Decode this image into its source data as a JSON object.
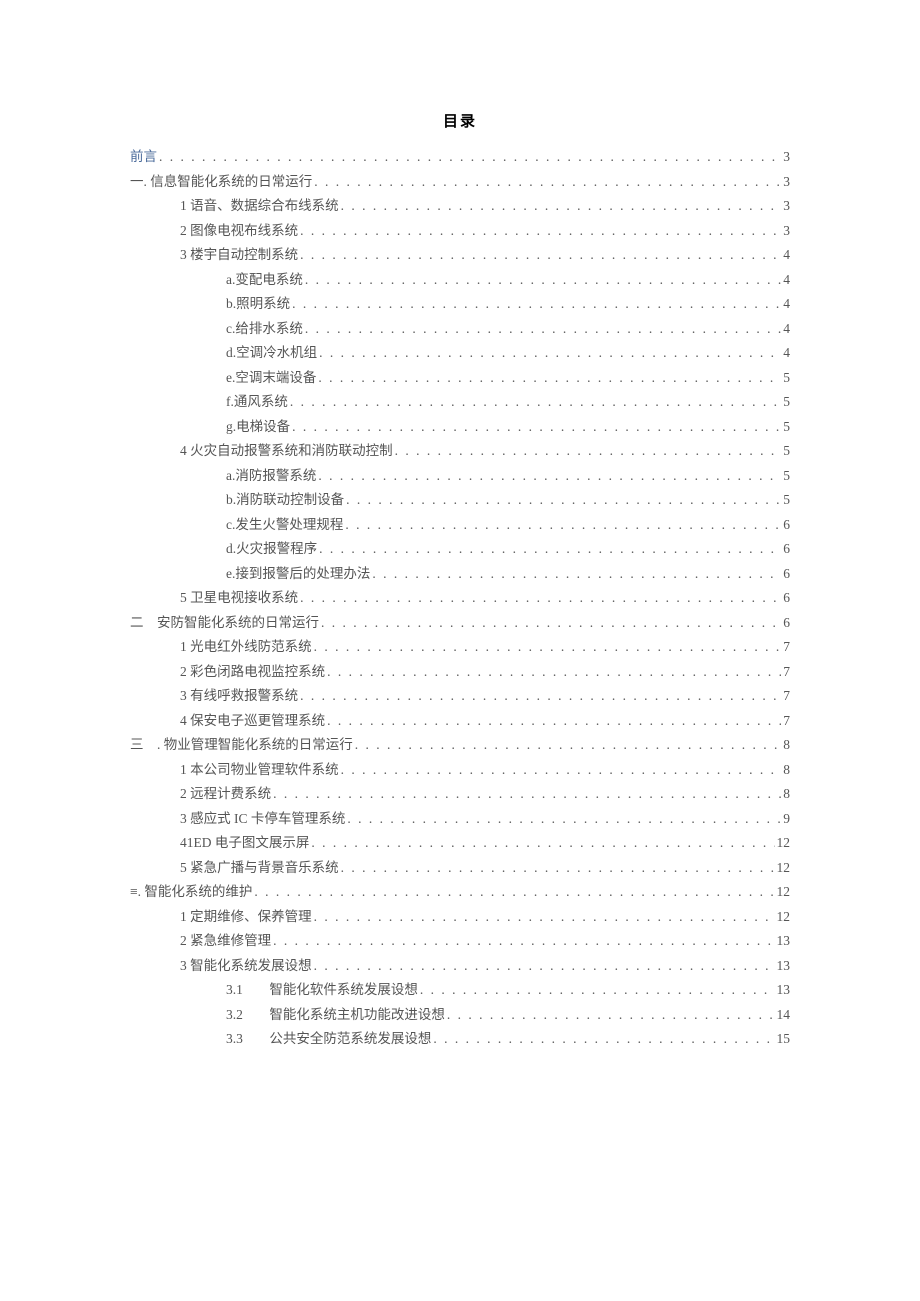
{
  "title": "目录",
  "entries": [
    {
      "level": 0,
      "label": "前言",
      "page": "3",
      "cls": "preface",
      "space": false
    },
    {
      "level": 0,
      "label": "一. 信息智能化系统的日常运行",
      "page": "3",
      "space": true
    },
    {
      "level": 1,
      "label": "1 语音、数据综合布线系统",
      "page": "3"
    },
    {
      "level": 1,
      "label": "2 图像电视布线系统",
      "page": "3"
    },
    {
      "level": 1,
      "label": "3 楼宇自动控制系统",
      "page": "4"
    },
    {
      "level": 2,
      "label": "a.变配电系统",
      "page": "4",
      "space": true
    },
    {
      "level": 2,
      "label": "b.照明系统",
      "page": "4",
      "space": true
    },
    {
      "level": 2,
      "label": "c.给排水系统",
      "page": "4",
      "space": true
    },
    {
      "level": 2,
      "label": "d.空调冷水机组",
      "page": "4",
      "space": true
    },
    {
      "level": 2,
      "label": "e.空调末端设备",
      "page": "5",
      "space": true
    },
    {
      "level": 2,
      "label": "f.通风系统",
      "page": "5"
    },
    {
      "level": 2,
      "label": "g.电梯设备",
      "page": "5",
      "space": true
    },
    {
      "level": 1,
      "label": "4 火灾自动报警系统和消防联动控制",
      "page": "5"
    },
    {
      "level": 2,
      "label": "a.消防报警系统",
      "page": "5",
      "space": true
    },
    {
      "level": 2,
      "label": "b.消防联动控制设备",
      "page": "5",
      "space": true
    },
    {
      "level": 2,
      "label": "c.发生火警处理规程",
      "page": "6",
      "space": true
    },
    {
      "level": 2,
      "label": "d.火灾报警程序",
      "page": "6",
      "space": true
    },
    {
      "level": 2,
      "label": "e.接到报警后的处理办法",
      "page": "6",
      "space": true
    },
    {
      "level": 1,
      "label": "5 卫星电视接收系统",
      "page": "6"
    },
    {
      "level": 0,
      "label": "二　安防智能化系统的日常运行",
      "page": "6"
    },
    {
      "level": 1,
      "label": "1 光电红外线防范系统",
      "page": "7",
      "space": true
    },
    {
      "level": 1,
      "label": "2 彩色闭路电视监控系统",
      "page": "7"
    },
    {
      "level": 1,
      "label": "3 有线呼救报警系统",
      "page": "7"
    },
    {
      "level": 1,
      "label": "4 保安电子巡更管理系统",
      "page": "7"
    },
    {
      "level": 0,
      "label": "三　. 物业管理智能化系统的日常运行",
      "page": "8"
    },
    {
      "level": 1,
      "label": "1 本公司物业管理软件系统",
      "page": "8"
    },
    {
      "level": 1,
      "label": "2 远程计费系统",
      "page": "8"
    },
    {
      "level": 1,
      "label": "3 感应式 IC 卡停车管理系统",
      "page": "9",
      "space": true
    },
    {
      "level": 1,
      "label": "41ED 电子图文展示屏",
      "page": "12"
    },
    {
      "level": 1,
      "label": "5 紧急广播与背景音乐系统",
      "page": "12"
    },
    {
      "level": 0,
      "label": "≡. 智能化系统的维护",
      "page": "12",
      "space": true
    },
    {
      "level": 1,
      "label": "1 定期维修、保养管理",
      "page": "12"
    },
    {
      "level": 1,
      "label": "2 紧急维修管理",
      "page": "13"
    },
    {
      "level": 1,
      "label": "3 智能化系统发展设想",
      "page": "13"
    },
    {
      "level": 2,
      "num": "3.1",
      "label": "智能化软件系统发展设想",
      "page": "13",
      "space": true
    },
    {
      "level": 2,
      "num": "3.2",
      "label": "智能化系统主机功能改进设想",
      "page": "14",
      "space": true
    },
    {
      "level": 2,
      "num": "3.3",
      "label": "公共安全防范系统发展设想",
      "page": "15",
      "space": true
    }
  ]
}
